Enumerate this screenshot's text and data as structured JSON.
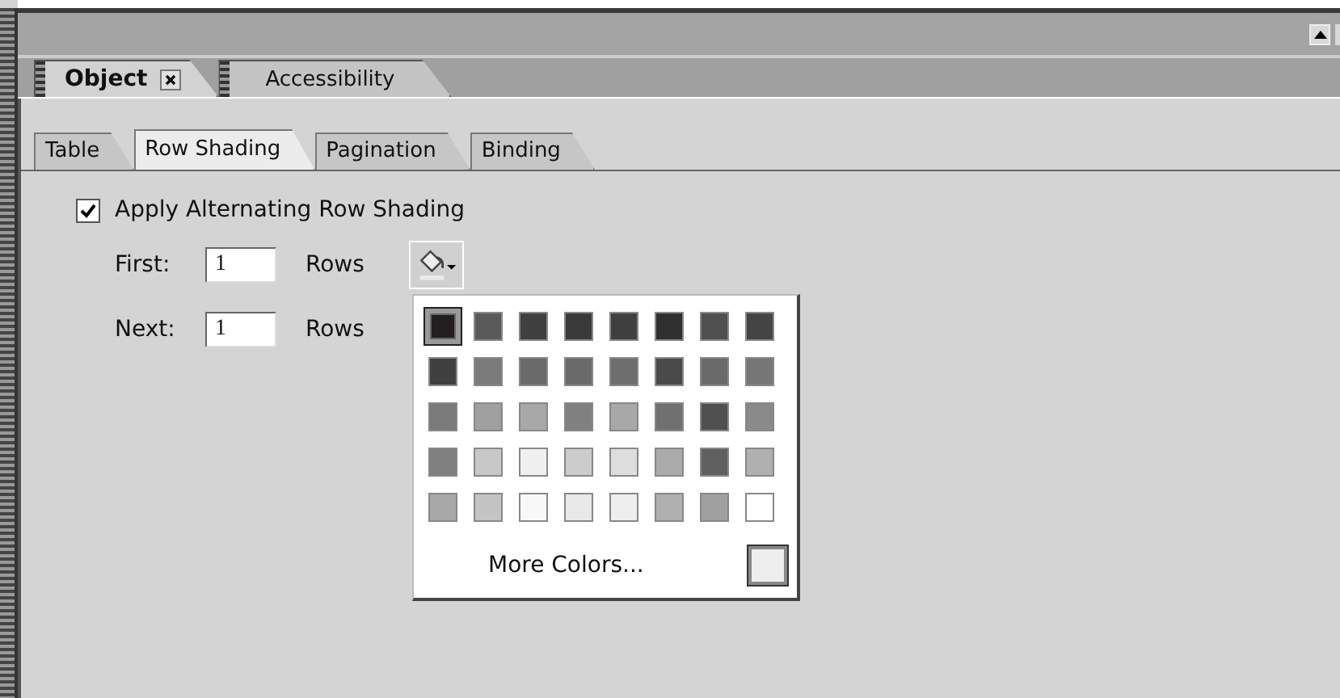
{
  "panel_tabs": [
    {
      "label": "Object",
      "selected": true,
      "closable": true
    },
    {
      "label": "Accessibility",
      "selected": false,
      "closable": false
    }
  ],
  "sub_tabs": [
    {
      "label": "Table",
      "selected": false
    },
    {
      "label": "Row Shading",
      "selected": true
    },
    {
      "label": "Pagination",
      "selected": false
    },
    {
      "label": "Binding",
      "selected": false
    }
  ],
  "shading_checkbox": {
    "label": "Apply Alternating Row Shading",
    "checked": true
  },
  "fields": [
    {
      "label": "First:",
      "value": "1",
      "unit": "Rows"
    },
    {
      "label": "Next:",
      "value": "1",
      "unit": "Rows"
    }
  ],
  "color_palette": {
    "swatches": [
      {
        "color": "#231f20",
        "selected": true
      },
      {
        "color": "#5a5a5a",
        "selected": false
      },
      {
        "color": "#404040",
        "selected": false
      },
      {
        "color": "#3a3a3a",
        "selected": false
      },
      {
        "color": "#404040",
        "selected": false
      },
      {
        "color": "#303030",
        "selected": false
      },
      {
        "color": "#505050",
        "selected": false
      },
      {
        "color": "#444444",
        "selected": false
      },
      {
        "color": "#404040",
        "selected": false
      },
      {
        "color": "#7a7a7a",
        "selected": false
      },
      {
        "color": "#6a6a6a",
        "selected": false
      },
      {
        "color": "#6a6a6a",
        "selected": false
      },
      {
        "color": "#6e6e6e",
        "selected": false
      },
      {
        "color": "#4a4a4a",
        "selected": false
      },
      {
        "color": "#6a6a6a",
        "selected": false
      },
      {
        "color": "#777777",
        "selected": false
      },
      {
        "color": "#7a7a7a",
        "selected": false
      },
      {
        "color": "#a0a0a0",
        "selected": false
      },
      {
        "color": "#a8a8a8",
        "selected": false
      },
      {
        "color": "#808080",
        "selected": false
      },
      {
        "color": "#a8a8a8",
        "selected": false
      },
      {
        "color": "#707070",
        "selected": false
      },
      {
        "color": "#505050",
        "selected": false
      },
      {
        "color": "#8a8a8a",
        "selected": false
      },
      {
        "color": "#808080",
        "selected": false
      },
      {
        "color": "#c8c8c8",
        "selected": false
      },
      {
        "color": "#f0f0f0",
        "selected": false
      },
      {
        "color": "#cccccc",
        "selected": false
      },
      {
        "color": "#dddddd",
        "selected": false
      },
      {
        "color": "#aaaaaa",
        "selected": false
      },
      {
        "color": "#606060",
        "selected": false
      },
      {
        "color": "#b0b0b0",
        "selected": false
      },
      {
        "color": "#a8a8a8",
        "selected": false
      },
      {
        "color": "#c4c4c4",
        "selected": false
      },
      {
        "color": "#f8f8f8",
        "selected": false
      },
      {
        "color": "#e8e8e8",
        "selected": false
      },
      {
        "color": "#eeeeee",
        "selected": false
      },
      {
        "color": "#b0b0b0",
        "selected": false
      },
      {
        "color": "#a0a0a0",
        "selected": false
      },
      {
        "color": "#ffffff",
        "selected": false
      }
    ],
    "more_colors": "More Colors..."
  }
}
